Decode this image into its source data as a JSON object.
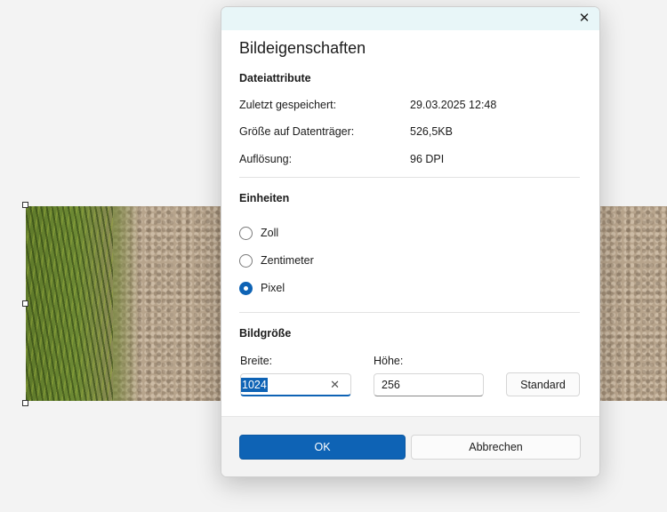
{
  "dialog": {
    "title": "Bildeigenschaften",
    "close_glyph": "✕",
    "file_attributes": {
      "heading": "Dateiattribute",
      "rows": [
        {
          "label": "Zuletzt gespeichert:",
          "value": "29.03.2025 12:48"
        },
        {
          "label": "Größe auf Datenträger:",
          "value": "526,5KB"
        },
        {
          "label": "Auflösung:",
          "value": "96 DPI"
        }
      ]
    },
    "units": {
      "heading": "Einheiten",
      "options": [
        {
          "label": "Zoll",
          "checked": false
        },
        {
          "label": "Zentimeter",
          "checked": false
        },
        {
          "label": "Pixel",
          "checked": true
        }
      ]
    },
    "image_size": {
      "heading": "Bildgröße",
      "width_label": "Breite:",
      "width_value": "1024",
      "height_label": "Höhe:",
      "height_value": "256",
      "clear_glyph": "✕",
      "default_button": "Standard"
    },
    "footer": {
      "ok_button": "OK",
      "cancel_button": "Abbrechen"
    }
  },
  "colors": {
    "accent": "#0e63b5",
    "titlebar": "#e8f6f8"
  }
}
